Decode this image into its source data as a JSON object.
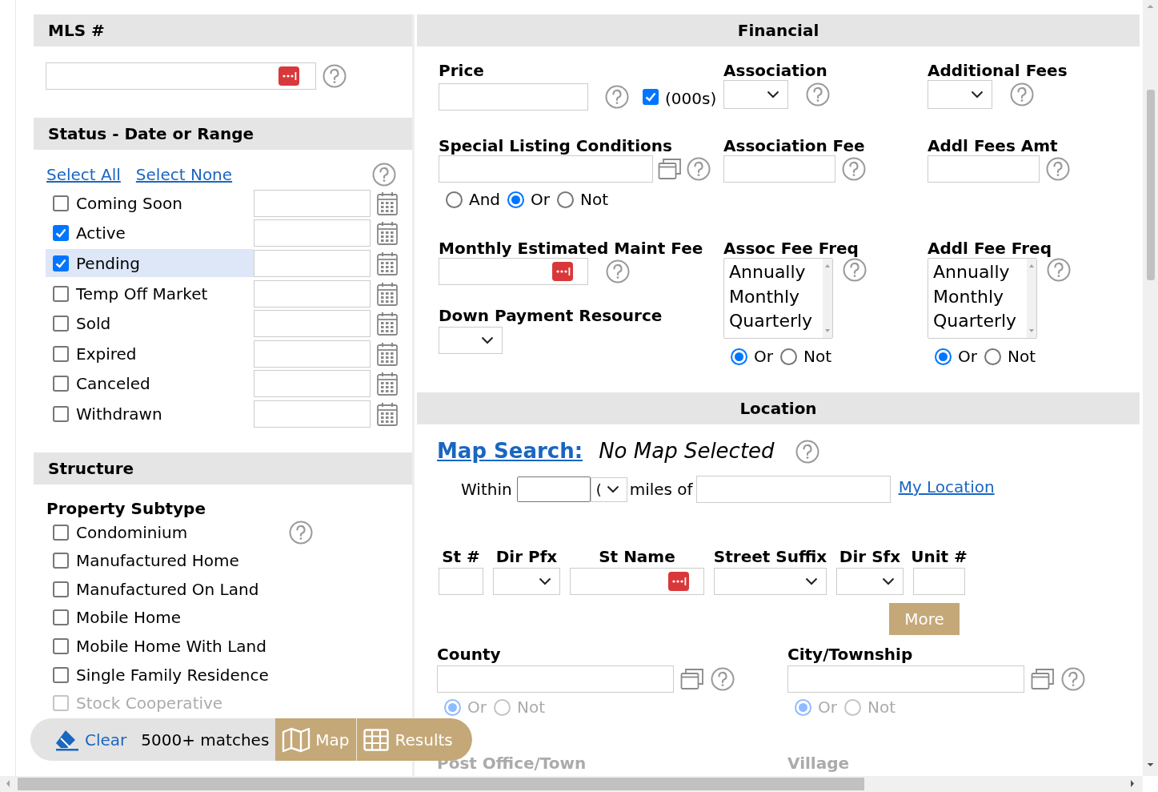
{
  "mls": {
    "title": "MLS #"
  },
  "status": {
    "title": "Status - Date or Range",
    "links": [
      "Select All",
      "Select None"
    ],
    "items": [
      {
        "label": "Coming Soon",
        "checked": false,
        "selected": false
      },
      {
        "label": "Active",
        "checked": true,
        "selected": false
      },
      {
        "label": "Pending",
        "checked": true,
        "selected": true
      },
      {
        "label": "Temp Off Market",
        "checked": false,
        "selected": false
      },
      {
        "label": "Sold",
        "checked": false,
        "selected": false
      },
      {
        "label": "Expired",
        "checked": false,
        "selected": false
      },
      {
        "label": "Canceled",
        "checked": false,
        "selected": false
      },
      {
        "label": "Withdrawn",
        "checked": false,
        "selected": false
      }
    ]
  },
  "structure": {
    "title": "Structure",
    "subtype_label": "Property Subtype",
    "items": [
      {
        "label": "Condominium",
        "checked": false,
        "faded": false
      },
      {
        "label": "Manufactured Home",
        "checked": false,
        "faded": false
      },
      {
        "label": "Manufactured On Land",
        "checked": false,
        "faded": false
      },
      {
        "label": "Mobile Home",
        "checked": false,
        "faded": false
      },
      {
        "label": "Mobile Home With Land",
        "checked": false,
        "faded": false
      },
      {
        "label": "Single Family Residence",
        "checked": false,
        "faded": false
      },
      {
        "label": "Stock Cooperative",
        "checked": false,
        "faded": true
      }
    ]
  },
  "financial": {
    "title": "Financial",
    "price": {
      "label": "Price",
      "thousands": {
        "label": "(000s)",
        "checked": true
      }
    },
    "association": {
      "label": "Association"
    },
    "additional_fees": {
      "label": "Additional Fees"
    },
    "special_listing_conditions": {
      "label": "Special Listing Conditions",
      "logic": [
        {
          "label": "And",
          "selected": false
        },
        {
          "label": "Or",
          "selected": true
        },
        {
          "label": "Not",
          "selected": false
        }
      ]
    },
    "association_fee": {
      "label": "Association Fee"
    },
    "addl_fees_amt": {
      "label": "Addl Fees Amt"
    },
    "monthly_maint_fee": {
      "label": "Monthly Estimated Maint Fee"
    },
    "down_payment_resource": {
      "label": "Down Payment Resource"
    },
    "assoc_fee_freq": {
      "label": "Assoc Fee Freq",
      "options": [
        "Annually",
        "Monthly",
        "Quarterly"
      ],
      "logic": [
        {
          "label": "Or",
          "selected": true
        },
        {
          "label": "Not",
          "selected": false
        }
      ]
    },
    "addl_fee_freq": {
      "label": "Addl Fee Freq",
      "options": [
        "Annually",
        "Monthly",
        "Quarterly"
      ],
      "logic": [
        {
          "label": "Or",
          "selected": true
        },
        {
          "label": "Not",
          "selected": false
        }
      ]
    }
  },
  "location": {
    "title": "Location",
    "map_search": {
      "link": "Map Search:",
      "status": "No Map Selected"
    },
    "radius": {
      "within": "Within",
      "unit": "(",
      "miles_of": "miles of",
      "my_location": "My Location"
    },
    "street_fields": [
      {
        "label": "St #",
        "kind": "text"
      },
      {
        "label": "Dir Pfx",
        "kind": "select"
      },
      {
        "label": "St Name",
        "kind": "lookup"
      },
      {
        "label": "Street Suffix",
        "kind": "select"
      },
      {
        "label": "Dir Sfx",
        "kind": "select"
      },
      {
        "label": "Unit #",
        "kind": "text"
      }
    ],
    "more": "More",
    "areas": [
      {
        "label": "County",
        "logic": {
          "faded": true,
          "options": [
            {
              "label": "Or",
              "selected": true
            },
            {
              "label": "Not",
              "selected": false
            }
          ]
        }
      },
      {
        "label": "City/Township",
        "logic": {
          "faded": true,
          "options": [
            {
              "label": "Or",
              "selected": true
            },
            {
              "label": "Not",
              "selected": false
            }
          ]
        }
      }
    ],
    "faded_labels": [
      {
        "label": "Post Office/Town",
        "faded": true
      },
      {
        "label": "Village",
        "faded": true
      }
    ]
  },
  "toolbar": {
    "clear": "Clear",
    "matches": "5000+ matches",
    "map": "Map",
    "results": "Results"
  }
}
